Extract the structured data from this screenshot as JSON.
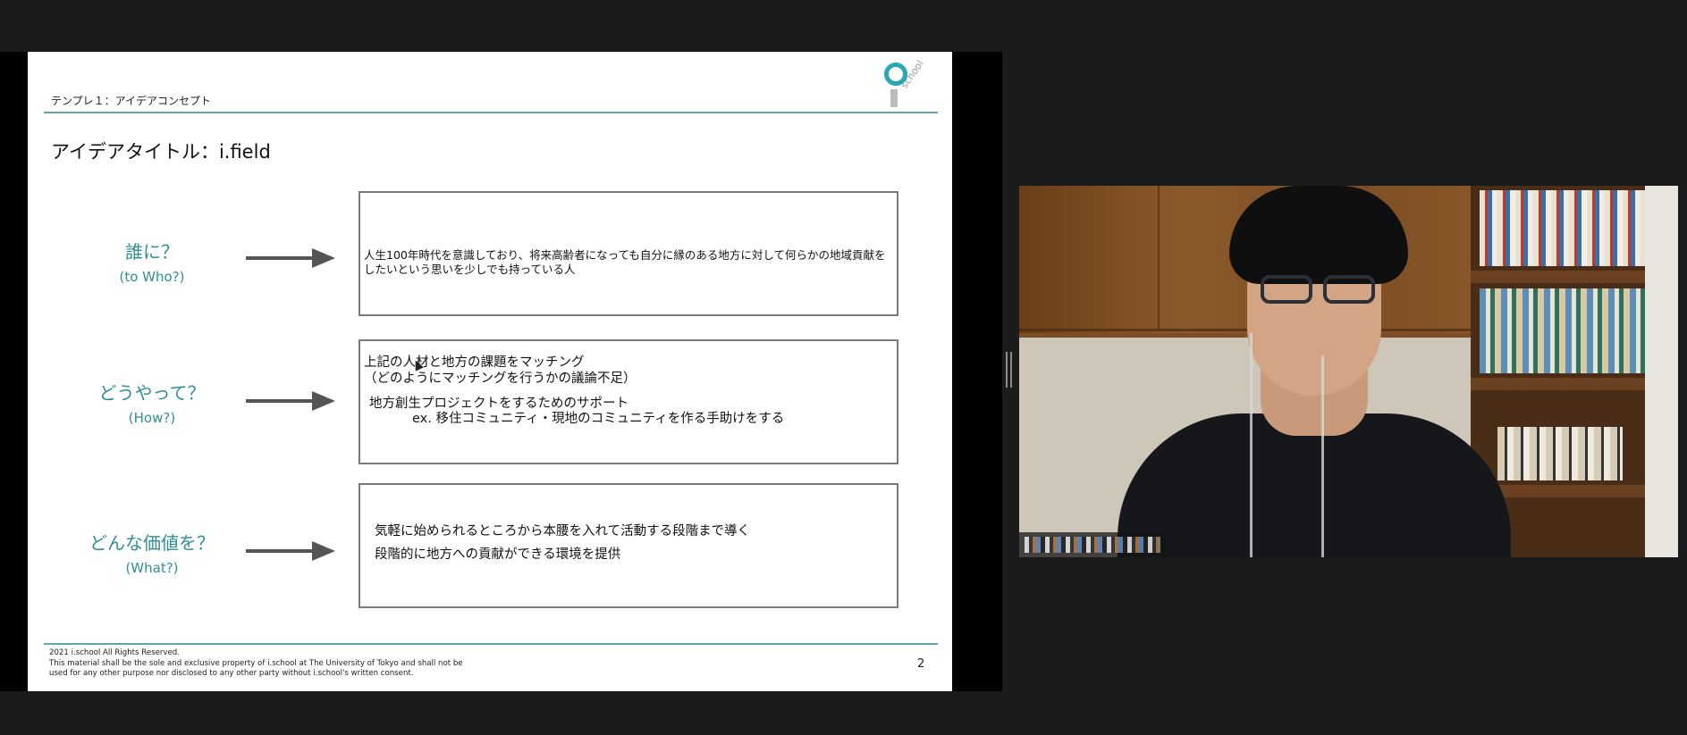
{
  "slide": {
    "header": "テンプレ１：アイデアコンセプト",
    "logo_text": "school",
    "title": "アイデアタイトル：i.field",
    "rows": [
      {
        "question": "誰に？",
        "question_en": "(to Who?)",
        "answer_lines": [
          "人生100年時代を意識しており、将来高齢者になっても自分に縁のある地方に対して何らかの地域貢献をしたいという思いを少しでも持っている人"
        ]
      },
      {
        "question": "どうやって？",
        "question_en": "(How?)",
        "answer_lines": [
          "上記の人材と地方の課題をマッチング",
          "（どのようにマッチングを行うかの議論不足）",
          "地方創生プロジェクトをするためのサポート",
          "ex. 移住コミュニティ・現地のコミュニティを作る手助けをする"
        ]
      },
      {
        "question": "どんな価値を？",
        "question_en": "(What?)",
        "answer_lines": [
          "気軽に始められるところから本腰を入れて活動する段階まで導く",
          "段階的に地方への貢献ができる環境を提供"
        ]
      }
    ],
    "footer": {
      "line1": "2021 i.school All Rights Reserved.",
      "line2": "This material shall be the sole and exclusive property of i.school at The University of Tokyo and shall not be",
      "line3": "used for any other purpose nor disclosed to any other party without i.school's written consent."
    },
    "page_number": "2"
  },
  "colors": {
    "accent_teal": "#2f8f93",
    "rule_teal": "#5aa9a8",
    "logo_teal": "#2aa6b5",
    "background_dark": "#1b1b1b"
  },
  "participant_video": {
    "name_label": ""
  }
}
